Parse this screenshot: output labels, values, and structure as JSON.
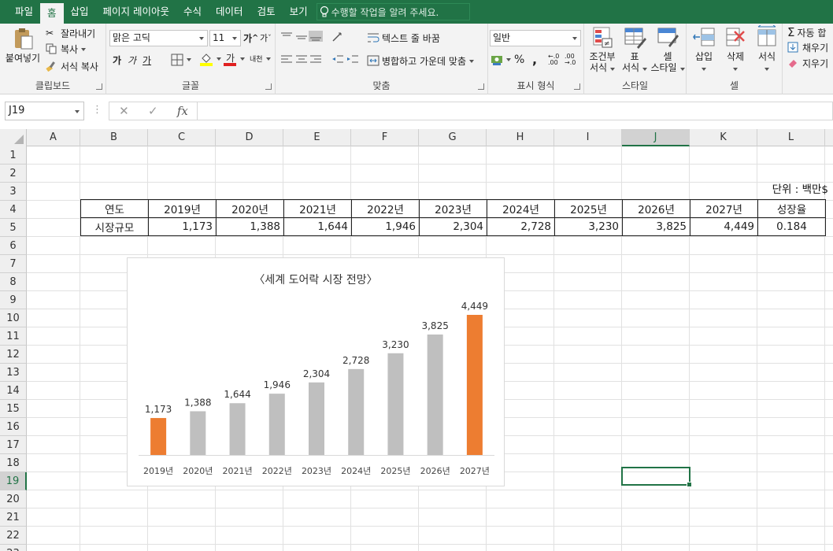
{
  "tabs": [
    "파일",
    "홈",
    "삽입",
    "페이지 레이아웃",
    "수식",
    "데이터",
    "검토",
    "보기"
  ],
  "active_tab": "홈",
  "tell_me": "수행할 작업을 알려 주세요.",
  "ribbon": {
    "clipboard": {
      "title": "클립보드",
      "paste": "붙여넣기",
      "cut": "잘라내기",
      "copy": "복사",
      "format_painter": "서식 복사"
    },
    "font": {
      "title": "글꼴",
      "name": "맑은 고딕",
      "size": "11",
      "bold": "가",
      "italic": "가",
      "underline": "가",
      "grow": "가",
      "shrink": "가",
      "phonetic": "내천"
    },
    "align": {
      "title": "맞춤",
      "wrap": "텍스트 줄 바꿈",
      "merge": "병합하고 가운데 맞춤"
    },
    "number": {
      "title": "표시 형식",
      "format": "일반",
      "percent": "%",
      "comma": ","
    },
    "styles": {
      "title": "스타일",
      "cond": "조건부",
      "cond2": "서식",
      "table": "표",
      "table2": "서식",
      "cell": "셀",
      "cell2": "스타일"
    },
    "cells": {
      "title": "셀",
      "insert": "삽입",
      "delete": "삭제",
      "format": "서식"
    },
    "editing": {
      "autosum": "자동 합",
      "fill": "채우기",
      "clear": "지우기"
    }
  },
  "namebox": "J19",
  "columns": [
    "A",
    "B",
    "C",
    "D",
    "E",
    "F",
    "G",
    "H",
    "I",
    "J",
    "K",
    "L"
  ],
  "selected_col": "J",
  "rows": [
    "1",
    "2",
    "3",
    "4",
    "5",
    "6",
    "7",
    "8",
    "9",
    "10",
    "11",
    "12",
    "13",
    "14",
    "15",
    "16",
    "17",
    "18",
    "19",
    "20",
    "21",
    "22",
    "23"
  ],
  "selected_row": "19",
  "unit_label": "단위 : 백만$",
  "table": {
    "header": [
      "연도",
      "2019년",
      "2020년",
      "2021년",
      "2022년",
      "2023년",
      "2024년",
      "2025년",
      "2026년",
      "2027년",
      "성장율"
    ],
    "row": [
      "시장규모",
      "1,173",
      "1,388",
      "1,644",
      "1,946",
      "2,304",
      "2,728",
      "3,230",
      "3,825",
      "4,449",
      "0.184"
    ]
  },
  "chart_title": "〈세계 도어락 시장 전망〉",
  "chart_data": {
    "type": "bar",
    "title": "〈세계 도어락 시장 전망〉",
    "categories": [
      "2019년",
      "2020년",
      "2021년",
      "2022년",
      "2023년",
      "2024년",
      "2025년",
      "2026년",
      "2027년"
    ],
    "values": [
      1173,
      1388,
      1644,
      1946,
      2304,
      2728,
      3230,
      3825,
      4449
    ],
    "value_labels": [
      "1,173",
      "1,388",
      "1,644",
      "1,946",
      "2,304",
      "2,728",
      "3,230",
      "3,825",
      "4,449"
    ],
    "colors": [
      "#ed7d31",
      "#bfbfbf",
      "#bfbfbf",
      "#bfbfbf",
      "#bfbfbf",
      "#bfbfbf",
      "#bfbfbf",
      "#bfbfbf",
      "#ed7d31"
    ],
    "ylim": [
      0,
      4449
    ],
    "grid": false,
    "legend": "none"
  }
}
